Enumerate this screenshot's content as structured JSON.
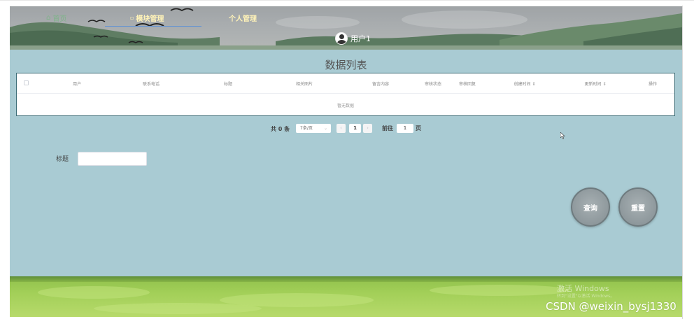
{
  "nav": {
    "home": "首页",
    "module_management": "模块管理",
    "personal_management": "个人管理"
  },
  "user": {
    "name": "用户1"
  },
  "page_title": "数据列表",
  "table": {
    "columns": [
      "用户",
      "联系电话",
      "标题",
      "相关图片",
      "留言内容",
      "审核状态",
      "审核回复",
      "创建时间 ⇕",
      "更新时间 ⇕",
      "操作"
    ],
    "empty_text": "暂无数据"
  },
  "pagination": {
    "total": "共 0 条",
    "page_size": "7条/页",
    "current_page": "1",
    "goto_label": "前往",
    "jump_value": "1",
    "page_label": "页"
  },
  "search": {
    "title_label": "标题",
    "title_value": "",
    "query_button": "查询",
    "reset_button": "重置"
  },
  "watermarks": {
    "windows_line1": "激活 Windows",
    "windows_line2": "转到\"设置\"以激活 Windows。",
    "csdn": "CSDN @weixin_bysj1330"
  },
  "colors": {
    "app_background": "#a9cbd3",
    "table_border": "#3e6e78",
    "nav_text": "#fff3b8",
    "nav_underline": "#5b8fd6",
    "button_fill": "#8e989c"
  }
}
